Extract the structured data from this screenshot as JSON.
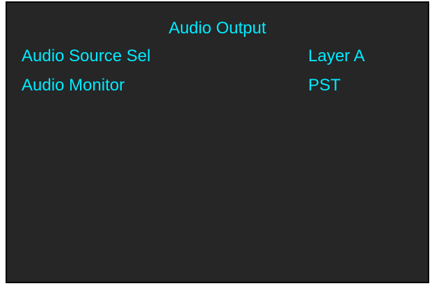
{
  "colors": {
    "background": "#262626",
    "border": "#000000",
    "text": "#00eaff"
  },
  "menu": {
    "title": "Audio Output",
    "items": [
      {
        "label": "Audio Source Sel",
        "value": "Layer A"
      },
      {
        "label": "Audio Monitor",
        "value": "PST"
      }
    ]
  }
}
